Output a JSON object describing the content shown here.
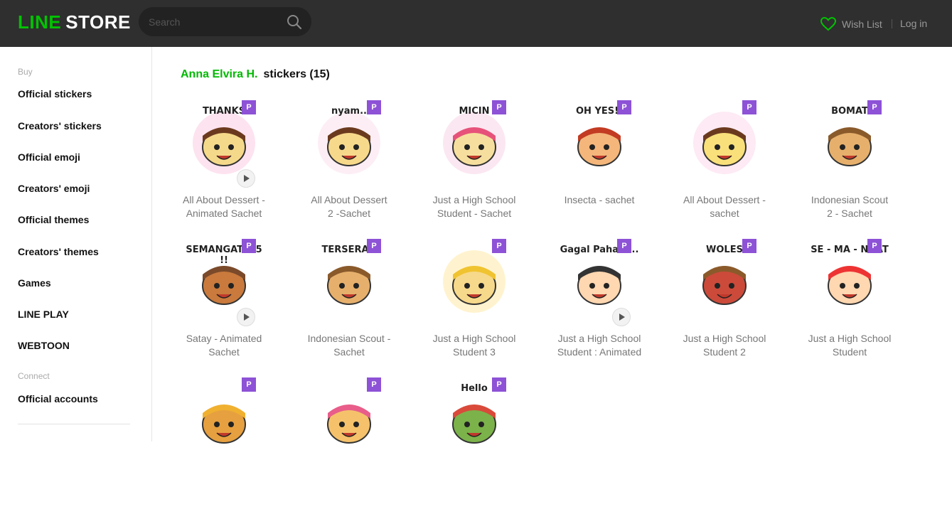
{
  "header": {
    "logo_line": "LINE",
    "logo_store": "STORE",
    "search_placeholder": "Search",
    "wishlist_label": "Wish List",
    "login_label": "Log in",
    "accent_color": "#00c300"
  },
  "sidebar": {
    "buy_heading": "Buy",
    "items": [
      {
        "label": "Official stickers"
      },
      {
        "label": "Creators' stickers"
      },
      {
        "label": "Official emoji"
      },
      {
        "label": "Creators' emoji"
      },
      {
        "label": "Official themes"
      },
      {
        "label": "Creators' themes"
      },
      {
        "label": "Games"
      },
      {
        "label": "LINE PLAY"
      },
      {
        "label": "WEBTOON"
      }
    ],
    "connect_heading": "Connect",
    "connect_items": [
      {
        "label": "Official accounts"
      }
    ]
  },
  "main": {
    "author": "Anna Elvira H.",
    "title_rest": "stickers (15)",
    "badge_label": "P",
    "stickers": [
      {
        "name_l1": "All About Dessert -",
        "name_l2": "Animated Sachet",
        "animated": true,
        "icon": "dessert-cake-sticker",
        "thumb_text": "THANKS"
      },
      {
        "name_l1": "All About Dessert",
        "name_l2": "2 -Sachet",
        "animated": false,
        "icon": "dessert-cake-sticker",
        "thumb_text": "nyam.."
      },
      {
        "name_l1": "Just a High School",
        "name_l2": "Student - Sachet",
        "animated": false,
        "icon": "schoolgirl-sticker",
        "thumb_text": "MICIN"
      },
      {
        "name_l1": "Insecta - sachet",
        "name_l2": "",
        "animated": false,
        "icon": "bug-sticker",
        "thumb_text": "OH YES!!"
      },
      {
        "name_l1": "All About Dessert -",
        "name_l2": "sachet",
        "animated": false,
        "icon": "pudding-sticker",
        "thumb_text": ""
      },
      {
        "name_l1": "Indonesian Scout",
        "name_l2": "2 - Sachet",
        "animated": false,
        "icon": "scout-sticker",
        "thumb_text": "BOMAT"
      },
      {
        "name_l1": "Satay - Animated",
        "name_l2": "Sachet",
        "animated": true,
        "icon": "satay-sticker",
        "thumb_text": "SEMANGAT '45 !!"
      },
      {
        "name_l1": "Indonesian Scout -",
        "name_l2": "Sachet",
        "animated": false,
        "icon": "scout-sticker",
        "thumb_text": "TERSERAH"
      },
      {
        "name_l1": "Just a High School",
        "name_l2": "Student 3",
        "animated": false,
        "icon": "schoolgirl-sticker",
        "thumb_text": ""
      },
      {
        "name_l1": "Just a High School",
        "name_l2": "Student : Animated",
        "animated": true,
        "icon": "schoolboy-sticker",
        "thumb_text": "Gagal Paham..."
      },
      {
        "name_l1": "Just a High School",
        "name_l2": "Student 2",
        "animated": false,
        "icon": "schoolboy-desk-sticker",
        "thumb_text": "WOLES"
      },
      {
        "name_l1": "Just a High School",
        "name_l2": "Student",
        "animated": false,
        "icon": "cheerleader-sticker",
        "thumb_text": "SE - MA - NGAT"
      },
      {
        "name_l1": "",
        "name_l2": "",
        "animated": false,
        "icon": "insects-group-sticker",
        "thumb_text": ""
      },
      {
        "name_l1": "",
        "name_l2": "",
        "animated": false,
        "icon": "icecream-sticker",
        "thumb_text": ""
      },
      {
        "name_l1": "",
        "name_l2": "",
        "animated": false,
        "icon": "fruit-basket-sticker",
        "thumb_text": "Hello"
      }
    ]
  }
}
